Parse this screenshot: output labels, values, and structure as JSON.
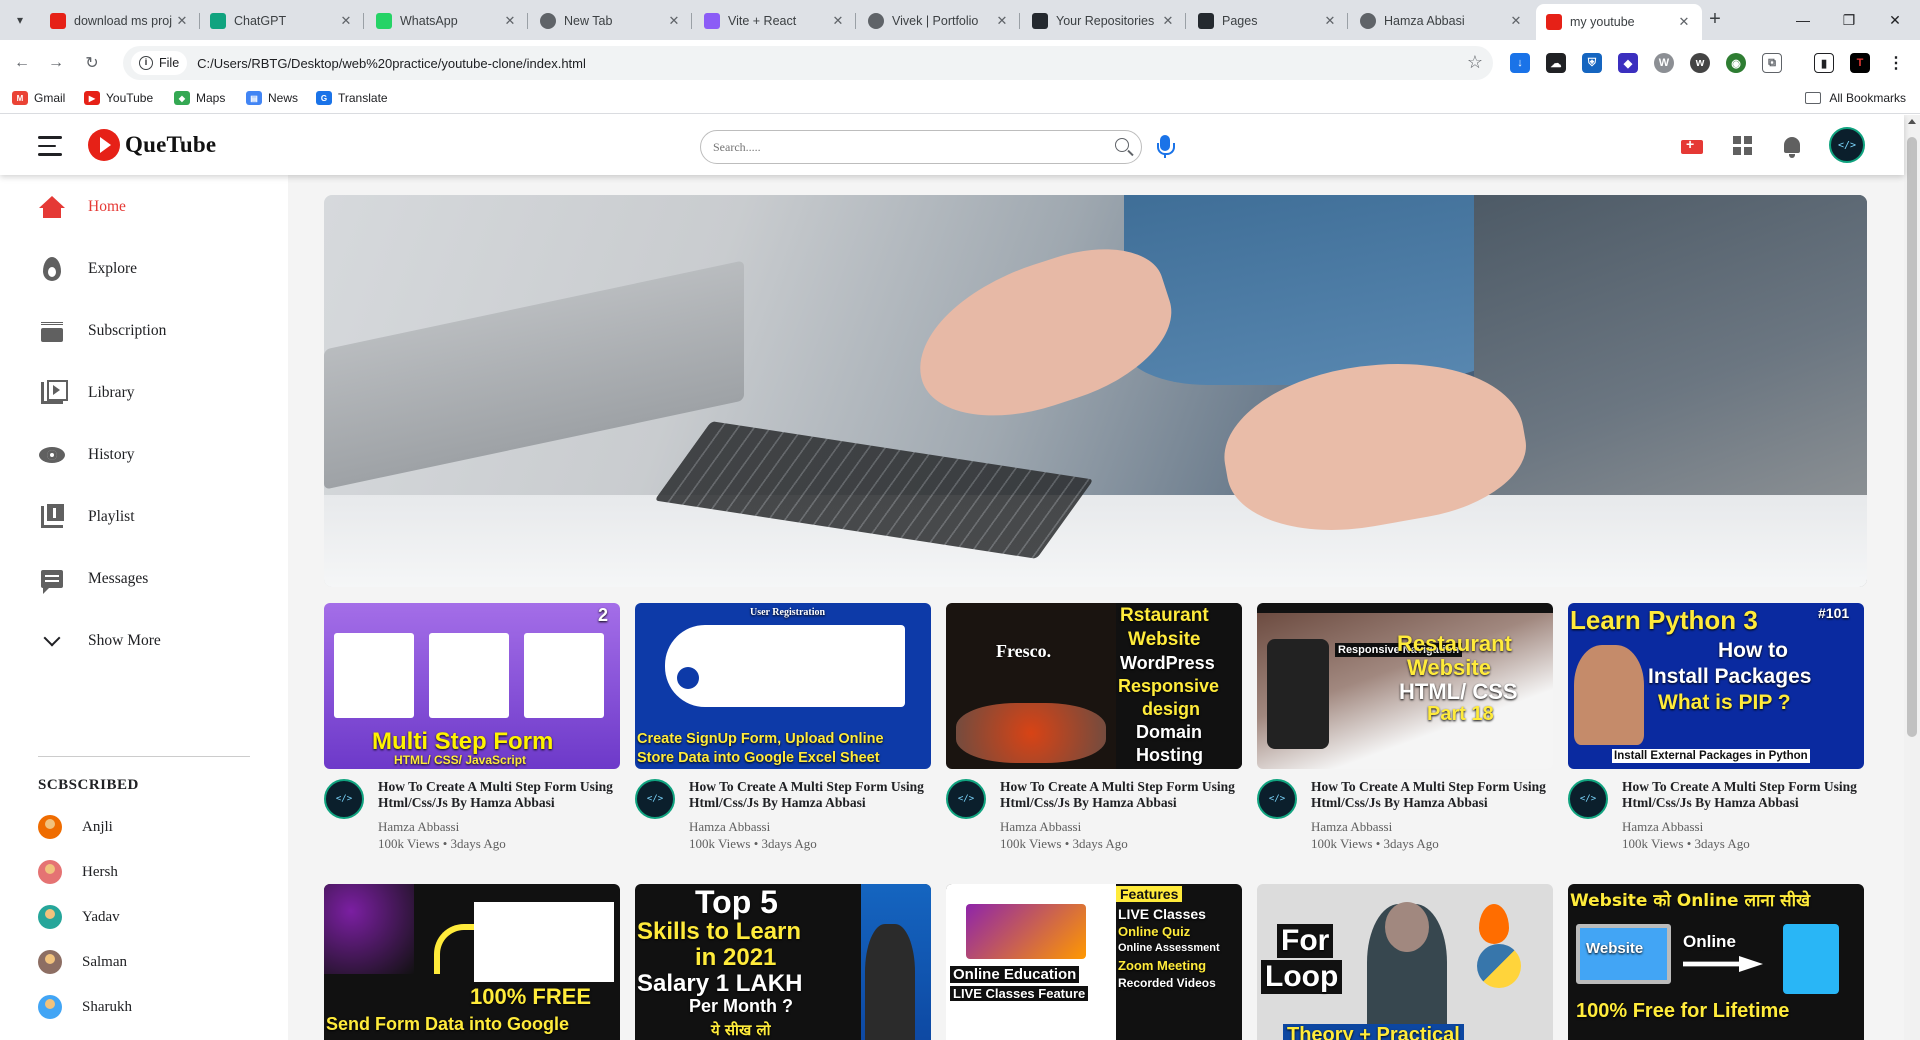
{
  "browser": {
    "tabs": [
      {
        "label": "download ms proj",
        "fav": "yt",
        "color": "#e62117"
      },
      {
        "label": "ChatGPT",
        "fav": "gpt",
        "color": "#10a37f"
      },
      {
        "label": "WhatsApp",
        "fav": "wa",
        "color": "#25d366"
      },
      {
        "label": "New Tab",
        "fav": "globe",
        "color": "#5f6368"
      },
      {
        "label": "Vite + React",
        "fav": "vite",
        "color": "#8b5cf6"
      },
      {
        "label": "Vivek | Portfolio",
        "fav": "globe",
        "color": "#5f6368"
      },
      {
        "label": "Your Repositories",
        "fav": "gh",
        "color": "#24292f"
      },
      {
        "label": "Pages",
        "fav": "gh",
        "color": "#24292f"
      },
      {
        "label": "Hamza Abbasi",
        "fav": "globe",
        "color": "#5f6368"
      },
      {
        "label": "my youtube",
        "fav": "yt",
        "color": "#e62117"
      }
    ],
    "url_label": "File",
    "url": "C:/Users/RBTG/Desktop/web%20practice/youtube-clone/index.html",
    "bookmarks": [
      "Gmail",
      "YouTube",
      "Maps",
      "News",
      "Translate"
    ],
    "all_bookmarks": "All Bookmarks"
  },
  "header": {
    "logo": "QueTube",
    "search_placeholder": "Search....."
  },
  "sidebar": {
    "items": [
      "Home",
      "Explore",
      "Subscription",
      "Library",
      "History",
      "Playlist",
      "Messages",
      "Show More"
    ],
    "subscribed_title": "SCBSCRIBED",
    "subscriptions": [
      "Anjli",
      "Hersh",
      "Yadav",
      "Salman",
      "Sharukh"
    ]
  },
  "videos": [
    {
      "title": "How To Create A Multi Step Form Using Html/Css/Js By Hamza Abbasi",
      "channel": "Hamza Abbassi",
      "stats": "100k Views • 3days Ago",
      "thumb_text": [
        "Multi Step Form",
        "HTML/ CSS/ JavaScript",
        "2"
      ]
    },
    {
      "title": "How To Create A Multi Step Form Using Html/Css/Js By Hamza Abbasi",
      "channel": "Hamza Abbassi",
      "stats": "100k Views • 3days Ago",
      "thumb_text": [
        "User Registration",
        "Create SignUp Form, Upload Online",
        "Store Data into Google Excel Sheet"
      ]
    },
    {
      "title": "How To Create A Multi Step Form Using Html/Css/Js By Hamza Abbasi",
      "channel": "Hamza Abbassi",
      "stats": "100k Views • 3days Ago",
      "thumb_text": [
        "Rstaurant",
        "Website",
        "WordPress",
        "Responsive",
        "design",
        "Domain",
        "Hosting",
        "Fresco."
      ]
    },
    {
      "title": "How To Create A Multi Step Form Using Html/Css/Js By Hamza Abbasi",
      "channel": "Hamza Abbassi",
      "stats": "100k Views • 3days Ago",
      "thumb_text": [
        "Restaurant",
        "Website",
        "HTML/ CSS",
        "Part 18",
        "Responsive Navigation"
      ]
    },
    {
      "title": "How To Create A Multi Step Form Using Html/Css/Js By Hamza Abbasi",
      "channel": "Hamza Abbassi",
      "stats": "100k Views • 3days Ago",
      "thumb_text": [
        "Learn Python 3",
        "#101",
        "How to",
        "Install Packages",
        "What is PIP ?",
        "Install External Packages in Python"
      ]
    }
  ],
  "videos_row2": [
    {
      "thumb_text": [
        "100% FREE",
        "Send Form Data into Google"
      ]
    },
    {
      "thumb_text": [
        "Top 5",
        "Skills to Learn",
        "in 2021",
        "Salary 1 LAKH",
        "Per Month ?",
        "ये सीख लो"
      ]
    },
    {
      "thumb_text": [
        "Features",
        "LIVE Classes",
        "Online Quiz",
        "Online Assessment",
        "Zoom Meeting",
        "Recorded Videos",
        "Online Education",
        "LIVE Classes Feature"
      ]
    },
    {
      "thumb_text": [
        "For",
        "Loop",
        "Theory + Practical"
      ]
    },
    {
      "thumb_text": [
        "Website को Online लाना सीखे",
        "Website",
        "Online",
        "100% Free for Lifetime"
      ]
    }
  ]
}
